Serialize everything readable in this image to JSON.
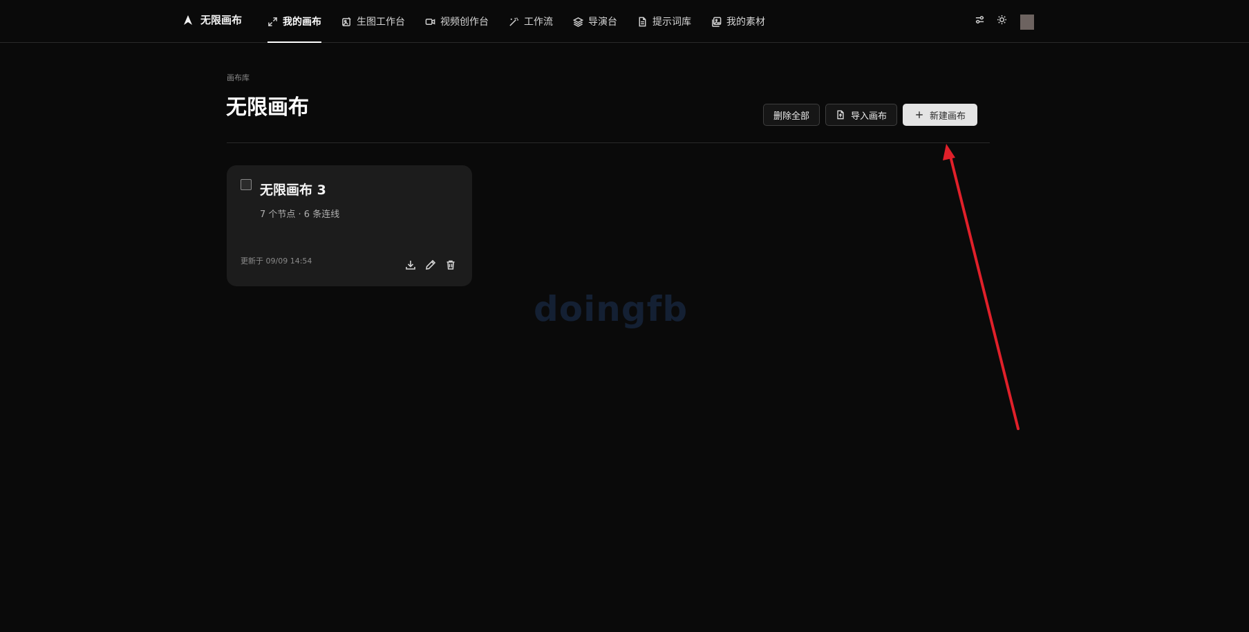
{
  "app": {
    "brand": "无限画布"
  },
  "nav": {
    "items": [
      {
        "label": "我的画布",
        "icon": "expand-arrows-icon",
        "active": true
      },
      {
        "label": "生图工作台",
        "icon": "image-edit-icon",
        "active": false
      },
      {
        "label": "视频创作台",
        "icon": "video-camera-icon",
        "active": false
      },
      {
        "label": "工作流",
        "icon": "magic-wand-icon",
        "active": false
      },
      {
        "label": "导演台",
        "icon": "layers-icon",
        "active": false
      },
      {
        "label": "提示词库",
        "icon": "document-icon",
        "active": false
      },
      {
        "label": "我的素材",
        "icon": "images-icon",
        "active": false
      }
    ]
  },
  "topright": {
    "settings_icon": "sliders-icon",
    "theme_icon": "sun-icon"
  },
  "header": {
    "breadcrumb": "画布库",
    "title": "无限画布"
  },
  "actions": {
    "delete_all": "删除全部",
    "import": "导入画布",
    "new": "新建画布"
  },
  "canvases": [
    {
      "title": "无限画布 3",
      "meta": "7 个节点 · 6 条连线",
      "updated": "更新于 09/09 14:54"
    }
  ],
  "watermark": "doingfb",
  "colors": {
    "background": "#0a0a0a",
    "card": "#1c1c1c",
    "annotation_arrow": "#e0202a",
    "primary_button": "#e4e4e4"
  }
}
